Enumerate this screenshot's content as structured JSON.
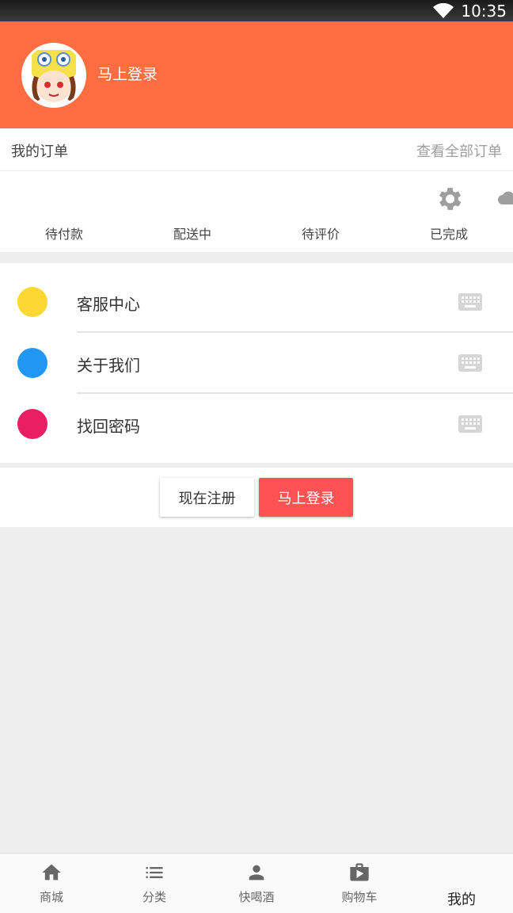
{
  "status_bar": {
    "time": "10:35"
  },
  "header": {
    "login_text": "马上登录"
  },
  "orders": {
    "title": "我的订单",
    "view_all": "查看全部订单",
    "statuses": [
      "待付款",
      "配送中",
      "待评价",
      "已完成"
    ]
  },
  "menu": {
    "items": [
      {
        "label": "客服中心",
        "color": "#fdd835"
      },
      {
        "label": "关于我们",
        "color": "#2196f3"
      },
      {
        "label": "找回密码",
        "color": "#e91e63"
      }
    ]
  },
  "buttons": {
    "register": "现在注册",
    "login": "马上登录"
  },
  "bottom_nav": {
    "items": [
      {
        "label": "商城",
        "icon": "home-icon"
      },
      {
        "label": "分类",
        "icon": "list-icon"
      },
      {
        "label": "快喝酒",
        "icon": "person-icon"
      },
      {
        "label": "购物车",
        "icon": "shop-icon"
      },
      {
        "label": "我的"
      }
    ]
  },
  "colors": {
    "header": "#ff6d40",
    "login_button": "#ff5252"
  }
}
